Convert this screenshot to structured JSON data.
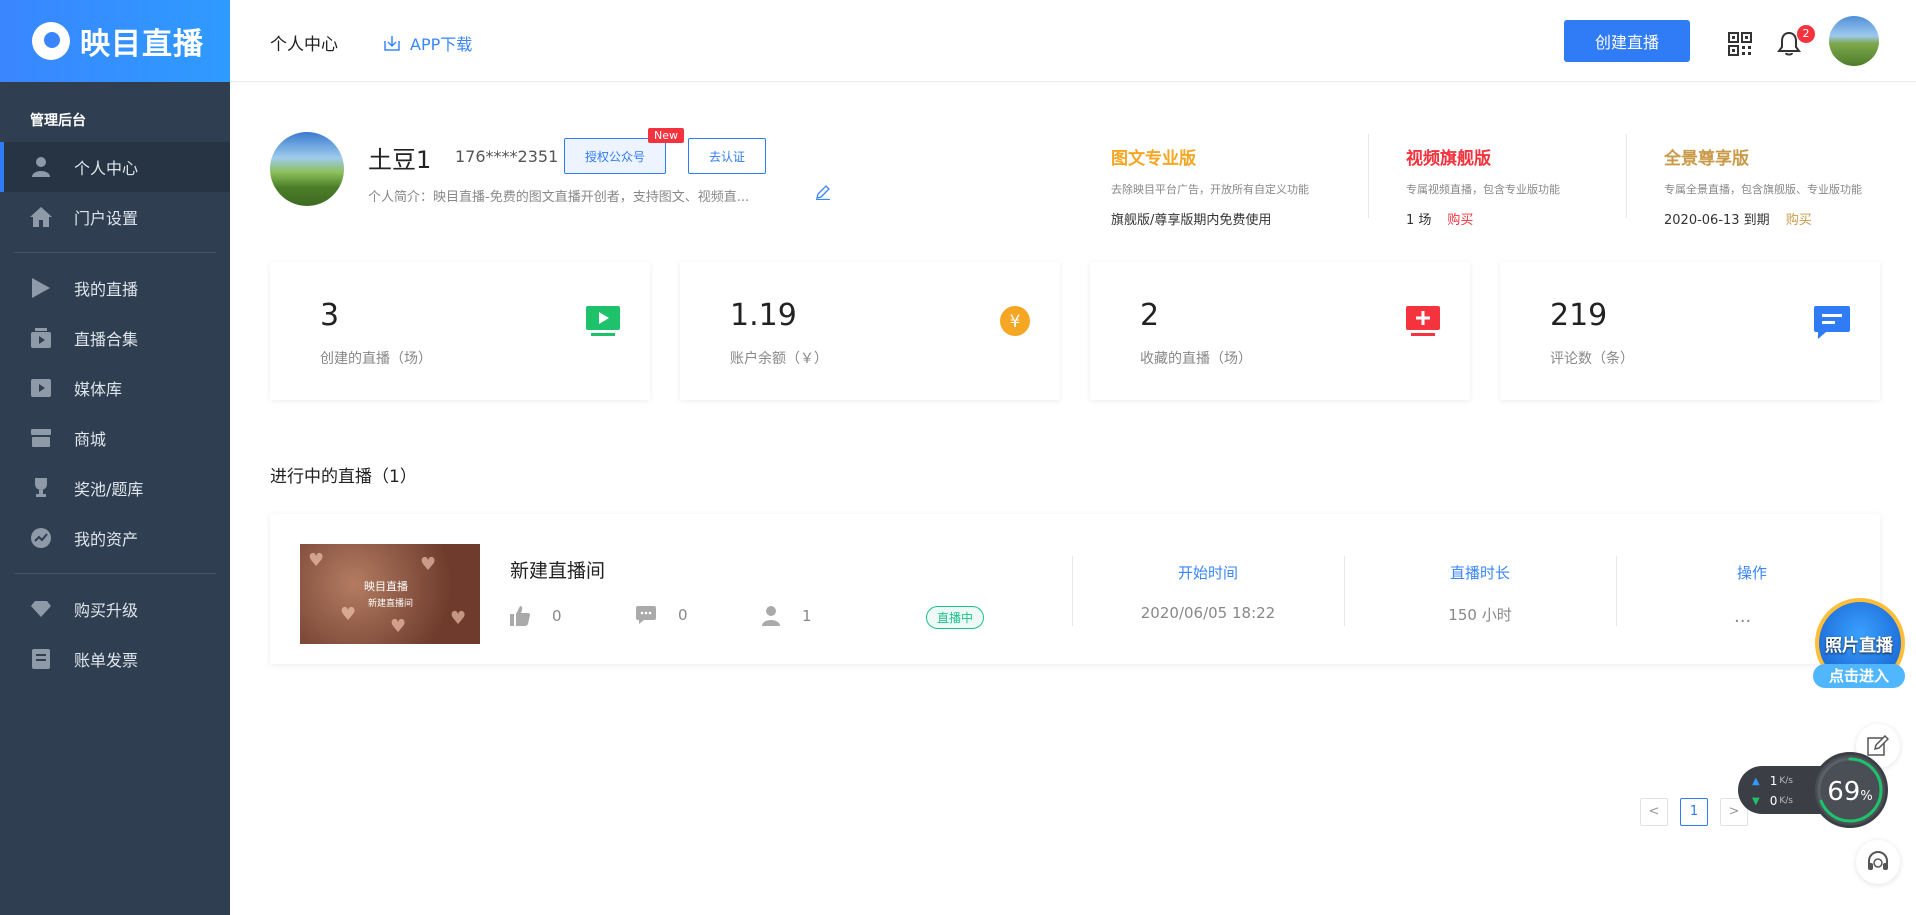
{
  "brand": {
    "name": "映目直播",
    "color": "#3a86ff"
  },
  "sidebar": {
    "section": "管理后台",
    "items": [
      {
        "label": "个人中心",
        "icon": "user-icon",
        "active": true
      },
      {
        "label": "门户设置",
        "icon": "home-icon"
      },
      {
        "label": "我的直播",
        "icon": "play-icon"
      },
      {
        "label": "直播合集",
        "icon": "collection-icon"
      },
      {
        "label": "媒体库",
        "icon": "film-icon"
      },
      {
        "label": "商城",
        "icon": "store-icon"
      },
      {
        "label": "奖池/题库",
        "icon": "trophy-icon"
      },
      {
        "label": "我的资产",
        "icon": "chart-icon"
      },
      {
        "label": "购买升级",
        "icon": "diamond-icon"
      },
      {
        "label": "账单发票",
        "icon": "invoice-icon"
      }
    ]
  },
  "header": {
    "title": "个人中心",
    "app_download": "APP下载",
    "create_button": "创建直播",
    "notification_count": "2"
  },
  "profile": {
    "name": "土豆1",
    "phone": "176****2351",
    "auth_button": "授权公众号",
    "new_badge": "New",
    "cert_button": "去认证",
    "intro": "个人简介：映目直播-免费的图文直播开创者，支持图文、视频直..."
  },
  "plans": [
    {
      "title": "图文专业版",
      "color": "#f5a623",
      "desc": "去除映目平台广告，开放所有自定义功能",
      "foot": "旗舰版/尊享版期内免费使用",
      "buy": ""
    },
    {
      "title": "视频旗舰版",
      "color": "#f5333f",
      "desc": "专属视频直播，包含专业版功能",
      "foot": "1 场",
      "buy": "购买",
      "buy_color": "#f5333f"
    },
    {
      "title": "全景尊享版",
      "color": "#c99a4a",
      "desc": "专属全景直播，包含旗舰版、专业版功能",
      "foot": "2020-06-13 到期",
      "buy": "购买",
      "buy_color": "#c99a4a"
    }
  ],
  "stats": [
    {
      "value": "3",
      "label": "创建的直播（场）",
      "icon": "tv-play-icon",
      "color": "#1ec26a"
    },
    {
      "value": "1.19",
      "label": "账户余额（￥）",
      "icon": "yuan-coin-icon",
      "color": "#f5a623"
    },
    {
      "value": "2",
      "label": "收藏的直播（场）",
      "icon": "tv-add-icon",
      "color": "#f5333f"
    },
    {
      "value": "219",
      "label": "评论数（条）",
      "icon": "comment-icon",
      "color": "#2f7cf6"
    }
  ],
  "live_section": {
    "title": "进行中的直播（1）",
    "item": {
      "thumb_logo": "映目直播",
      "thumb_sub": "新建直播间",
      "name": "新建直播间",
      "likes": "0",
      "comments": "0",
      "viewers": "1",
      "status": "直播中",
      "start_label": "开始时间",
      "start_value": "2020/06/05 18:22",
      "duration_label": "直播时长",
      "duration_value": "150 小时",
      "action_label": "操作",
      "action_value": "..."
    }
  },
  "pagination": {
    "prev": "<",
    "current": "1",
    "next": ">"
  },
  "floating": {
    "photo_live_title": "照片直播",
    "photo_live_sub": "点击进入",
    "upload_speed": "1",
    "download_speed": "0",
    "speed_unit": "K/s",
    "memory_pct": "69",
    "pct_unit": "%"
  }
}
